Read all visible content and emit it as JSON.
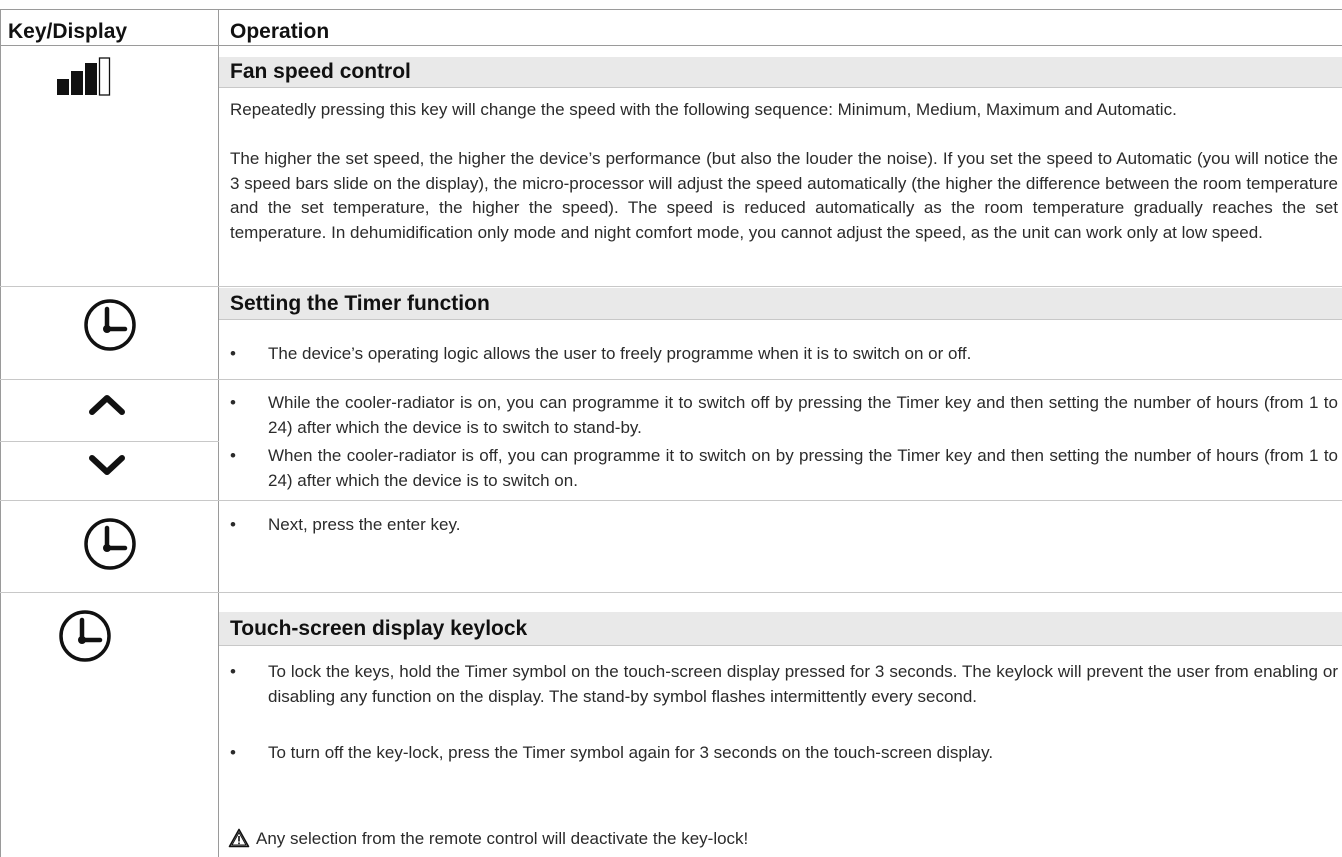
{
  "header": {
    "col1": "Key/Display",
    "col2": "Operation"
  },
  "rows": {
    "fan": {
      "icon": "fan-speed-bars-icon",
      "title": "Fan speed control",
      "paragraphs": [
        "Repeatedly pressing this key will change the speed with the following sequence: Minimum, Medium, Maximum and Automatic.",
        "The higher the set speed, the higher the device’s performance (but also the louder the noise). If you set the speed to Automatic (you will notice the 3 speed bars slide on the display), the micro-processor will adjust the speed automatically (the higher the difference between the room temperature and the set temperature, the higher the speed). The speed is reduced automatically as the room temperature gradually reaches the set temperature. In dehumidification only mode and night comfort mode, you cannot adjust the speed, as the unit can work only at low speed."
      ]
    },
    "timer": {
      "icon": "clock-icon",
      "title": "Setting the Timer function",
      "bullet": "The device’s operating logic allows the user to freely programme when it is to switch on or off."
    },
    "updown": {
      "icons": [
        "chevron-up-icon",
        "chevron-down-icon"
      ],
      "bullets": [
        "While the cooler-radiator is on, you can programme it to switch off by pressing the Timer key and then setting the number of hours (from 1 to 24) after which the device is to switch to stand-by.",
        "When the cooler-radiator is off, you can programme it to switch on by pressing the Timer key and then setting the number of hours (from 1 to 24) after which the device is to switch on."
      ]
    },
    "enter": {
      "icon": "clock-icon",
      "bullet": " Next, press the enter key."
    },
    "keylock": {
      "icon": "clock-icon",
      "title": "Touch-screen display keylock",
      "bullets": [
        "To lock the keys, hold the Timer symbol on the touch-screen display pressed for 3 seconds. The keylock will prevent the user from enabling or disabling any function on the display. The stand-by symbol flashes intermittently every second.",
        "To turn off the key-lock, press the Timer symbol again for 3 seconds on the touch-screen display."
      ],
      "warning_icon": "warning-triangle-icon",
      "warning": "Any selection from the remote control will deactivate the key-lock!"
    }
  },
  "bullet_char": "•"
}
